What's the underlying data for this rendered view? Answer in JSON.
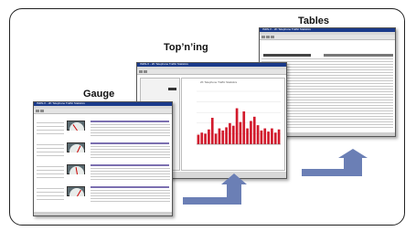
{
  "labels": {
    "gauge": "Gauge",
    "topning": "Top’n’ing",
    "tables": "Tables"
  },
  "windows": {
    "gauge": {
      "title": "ISDN-X - 2K Telephone Traffic Statistics"
    },
    "topning": {
      "title": "ISDN-X - 2K Telephone Traffic Statistics",
      "chart_title": "2K Telephone Traffic Statistics"
    },
    "tables": {
      "title": "ISDN-X - 2K Telephone Traffic Statistics"
    }
  },
  "colors": {
    "arrow": "#6b7fb5",
    "bars": "#d21a2c",
    "titlebar": "#1a3a8a"
  },
  "chart_data": {
    "type": "bar",
    "categories": [
      "1",
      "2",
      "3",
      "4",
      "5",
      "6",
      "7",
      "8",
      "9",
      "10",
      "11",
      "12",
      "13",
      "14",
      "15",
      "16",
      "17",
      "18",
      "19",
      "20",
      "21",
      "22",
      "23",
      "24"
    ],
    "values": [
      18,
      22,
      20,
      28,
      50,
      20,
      30,
      26,
      32,
      40,
      35,
      68,
      42,
      62,
      30,
      44,
      52,
      36,
      26,
      30,
      24,
      30,
      22,
      28
    ],
    "ylim": [
      0,
      100
    ]
  }
}
